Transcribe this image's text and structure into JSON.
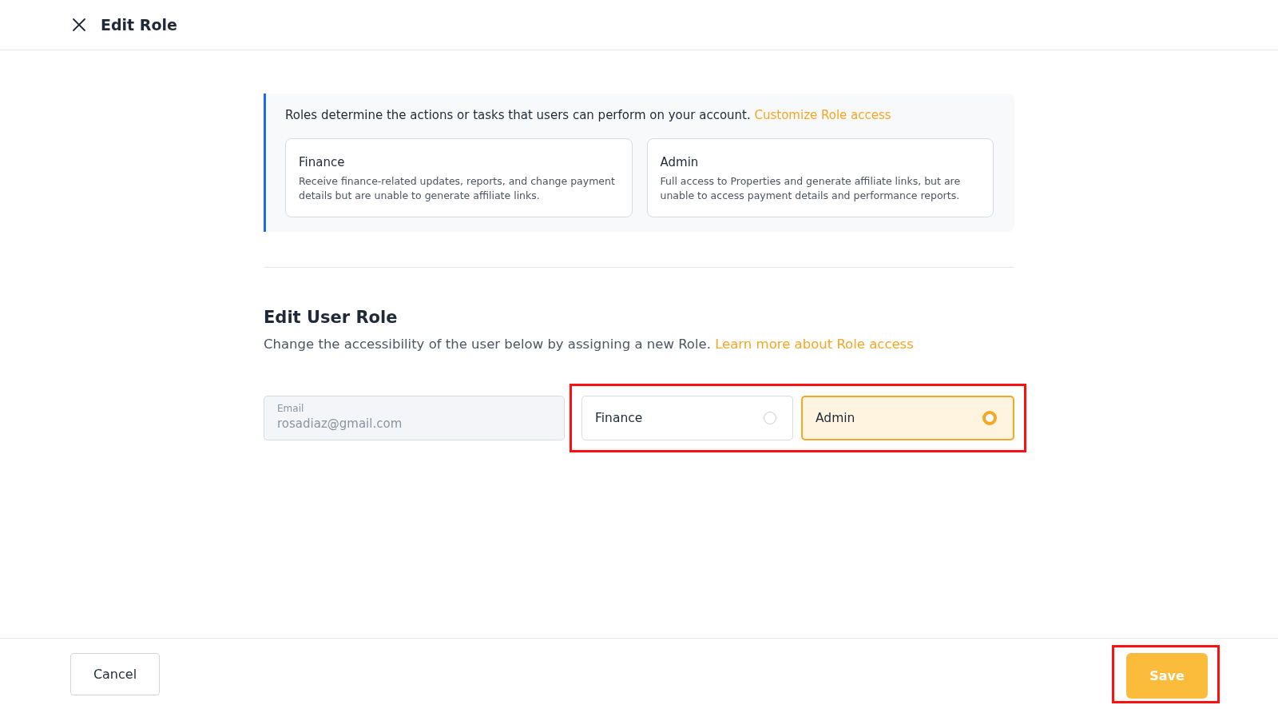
{
  "header": {
    "title": "Edit Role"
  },
  "info": {
    "text": "Roles determine the actions or tasks that users can perform on your account.",
    "link": "Customize Role access",
    "roles": [
      {
        "name": "Finance",
        "description": "Receive finance-related updates, reports, and change payment details but are unable to generate affiliate links."
      },
      {
        "name": "Admin",
        "description": "Full access to Properties and generate affiliate links, but are unable to access payment details and performance reports."
      }
    ]
  },
  "edit_user_role": {
    "heading": "Edit User Role",
    "description": "Change the accessibility of the user below by assigning a new Role.",
    "link": "Learn more about Role access",
    "email_field": {
      "label": "Email",
      "value": "rosadiaz@gmail.com",
      "disabled": true
    },
    "role_picker": {
      "highlighted": true,
      "options": [
        {
          "label": "Finance",
          "selected": false
        },
        {
          "label": "Admin",
          "selected": true
        }
      ]
    }
  },
  "footer": {
    "cancel_button": "Cancel",
    "save_button": {
      "label": "Save",
      "highlighted": true
    }
  }
}
